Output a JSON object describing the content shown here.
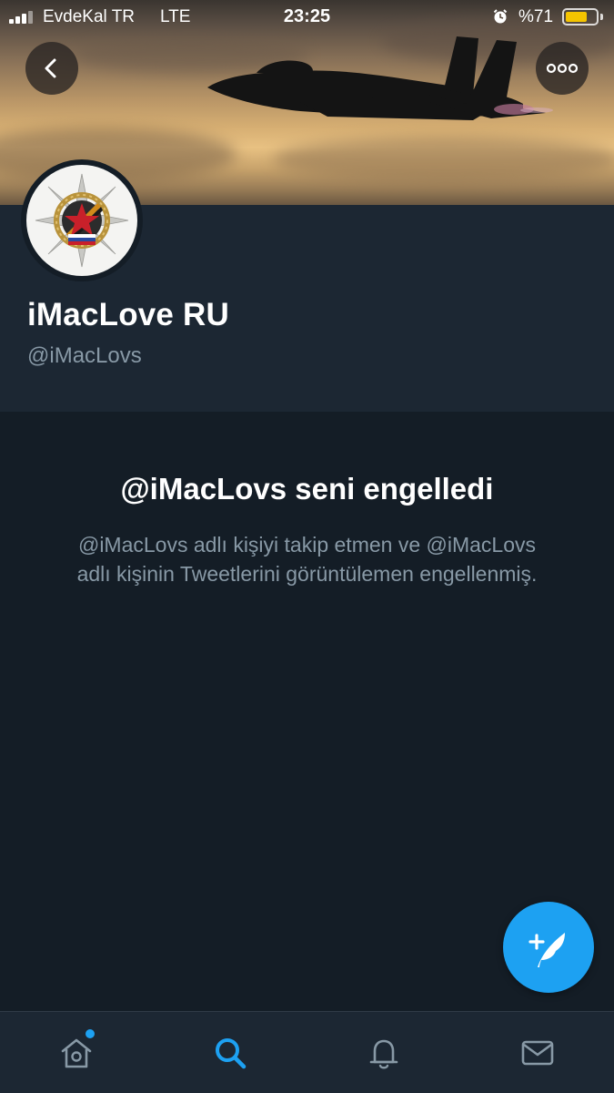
{
  "status_bar": {
    "carrier": "EvdeKal TR",
    "network": "LTE",
    "time": "23:25",
    "battery_text": "%71",
    "battery_level": 0.71,
    "battery_color": "#f5c400"
  },
  "banner": {
    "back_icon": "chevron-left-icon",
    "more_icon": "more-horizontal-icon"
  },
  "profile": {
    "display_name": "iMacLove RU",
    "handle": "@iMacLovs"
  },
  "blocked_notice": {
    "title": "@iMacLovs seni engelledi",
    "text": "@iMacLovs adlı kişiyi takip etmen ve @iMacLovs adlı kişinin Tweetlerini görüntülemen engellenmiş."
  },
  "compose_button": {
    "icon": "compose-tweet-icon",
    "color": "#1da1f2"
  },
  "tab_bar": {
    "items": [
      {
        "icon": "home-icon",
        "active": false,
        "has_notification_dot": true
      },
      {
        "icon": "search-icon",
        "active": true
      },
      {
        "icon": "notifications-bell-icon",
        "active": false
      },
      {
        "icon": "messages-envelope-icon",
        "active": false
      }
    ],
    "active_color": "#1da1f2",
    "inactive_color": "#8899a6"
  },
  "colors": {
    "background": "#141d26",
    "header_background": "#1c2733",
    "secondary_text": "#8899a6",
    "accent": "#1da1f2"
  }
}
